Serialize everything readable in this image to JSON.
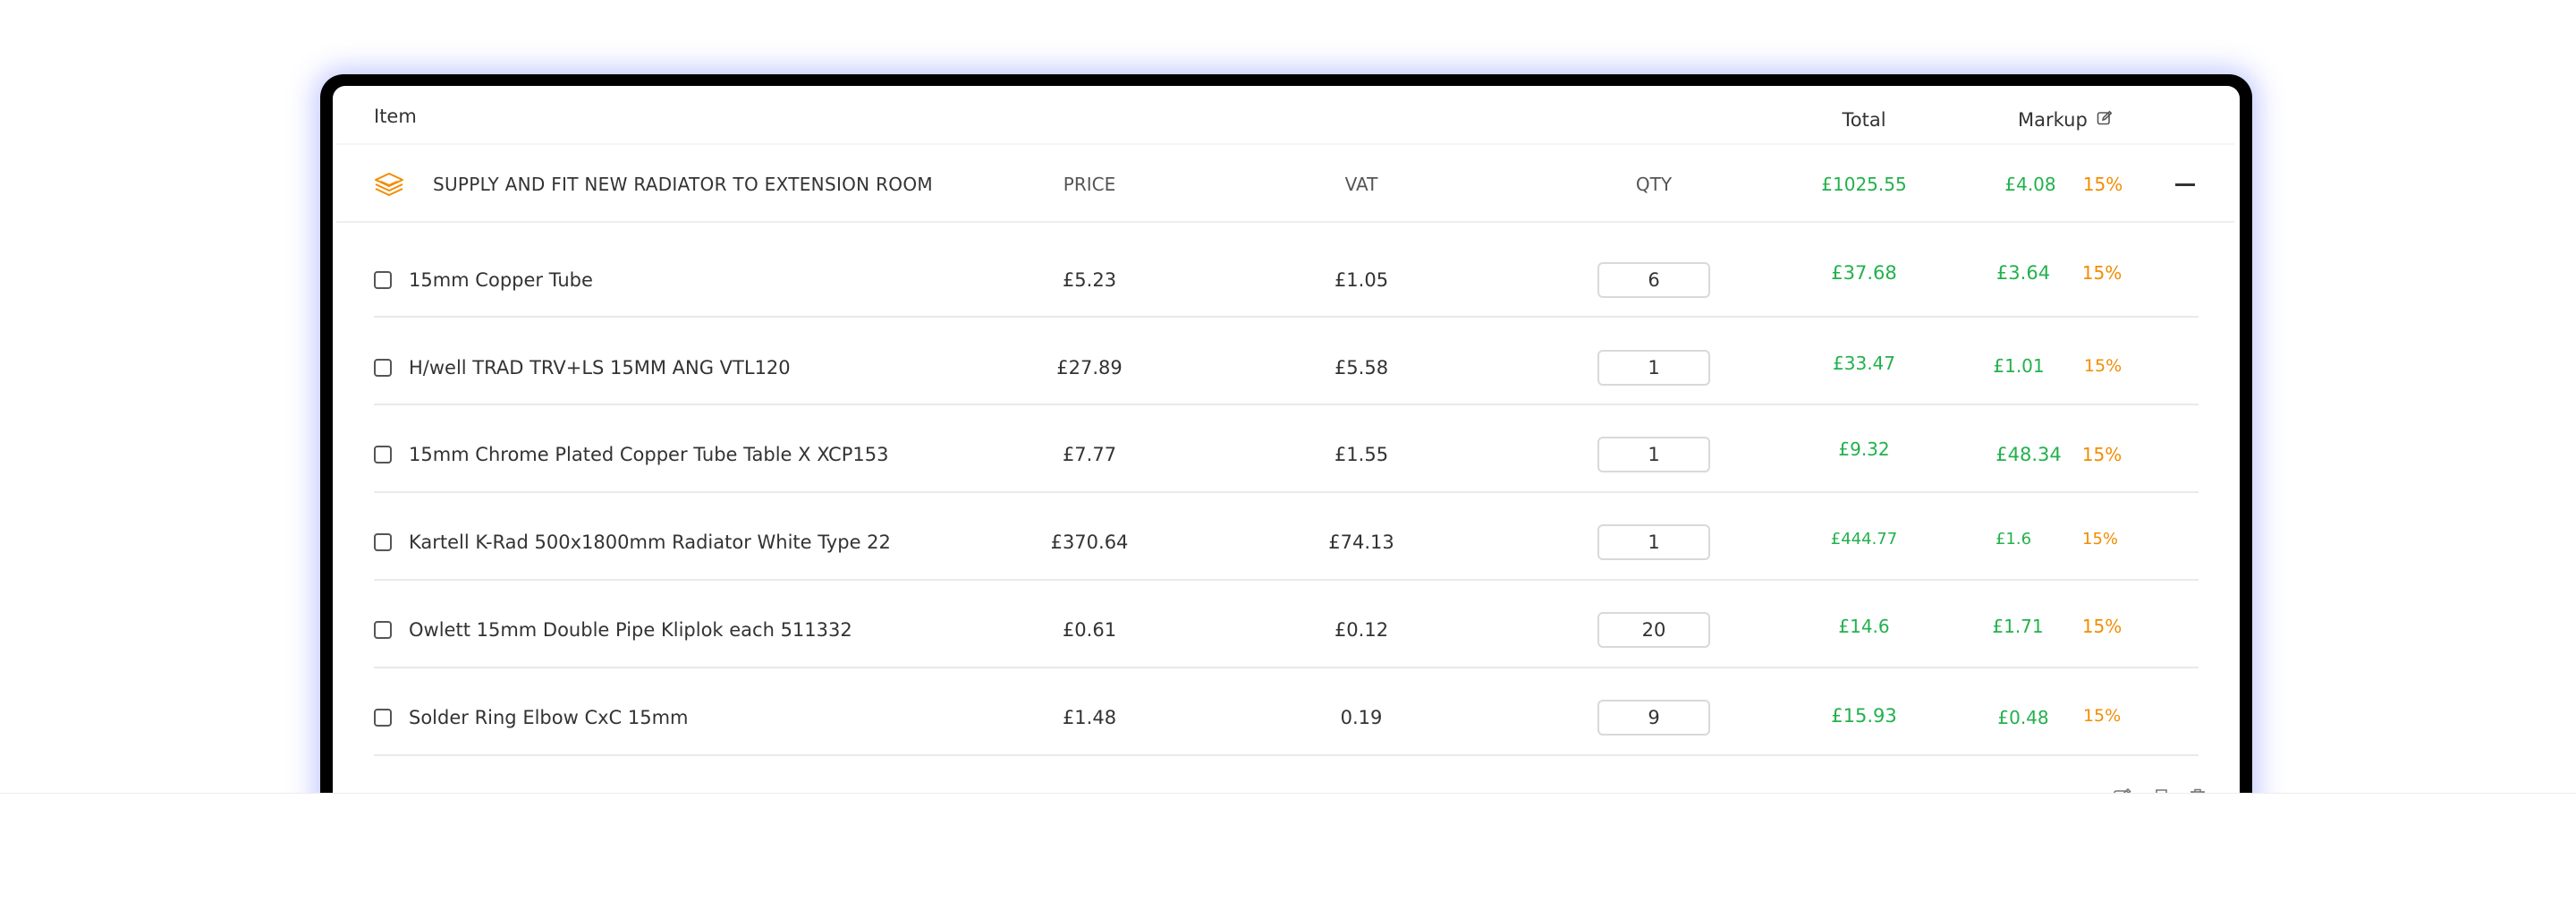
{
  "header": {
    "item_label": "Item",
    "total_label": "Total",
    "markup_label": "Markup"
  },
  "group": {
    "title": "SUPPLY AND FIT NEW RADIATOR TO EXTENSION ROOM",
    "price_label": "PRICE",
    "vat_label": "VAT",
    "qty_label": "QTY",
    "total": "£1025.55",
    "markup_value": "£4.08",
    "markup_percent": "15%",
    "icon": "stack-layers-icon"
  },
  "items": [
    {
      "name": "15mm Copper Tube",
      "price": "£5.23",
      "vat": "£1.05",
      "qty": "6",
      "total": "£37.68",
      "markup_value": "£3.64",
      "markup_percent": "15%"
    },
    {
      "name": "H/well TRAD TRV+LS 15MM ANG VTL120",
      "price": "£27.89",
      "vat": "£5.58",
      "qty": "1",
      "total": "£33.47",
      "markup_value": "£1.01",
      "markup_percent": "15%"
    },
    {
      "name": "15mm Chrome Plated Copper Tube Table X XCP153",
      "price": "£7.77",
      "vat": "£1.55",
      "qty": "1",
      "total": "£9.32",
      "markup_value": "£48.34",
      "markup_percent": "15%"
    },
    {
      "name": "Kartell K-Rad 500x1800mm Radiator White Type 22",
      "price": "£370.64",
      "vat": "£74.13",
      "qty": "1",
      "total": "£444.77",
      "markup_value": "£1.6",
      "markup_percent": "15%"
    },
    {
      "name": "Owlett 15mm Double Pipe Kliplok each 511332",
      "price": "£0.61",
      "vat": "£0.12",
      "qty": "20",
      "total": "£14.6",
      "markup_value": "£1.71",
      "markup_percent": "15%"
    },
    {
      "name": "Solder Ring Elbow CxC 15mm",
      "price": "£1.48",
      "vat": "0.19",
      "qty": "9",
      "total": "£15.93",
      "markup_value": "£0.48",
      "markup_percent": "15%"
    }
  ],
  "colors": {
    "green": "#22b14c",
    "orange": "#f28c00",
    "device_frame": "#000000",
    "glow": "#5f6eff"
  }
}
